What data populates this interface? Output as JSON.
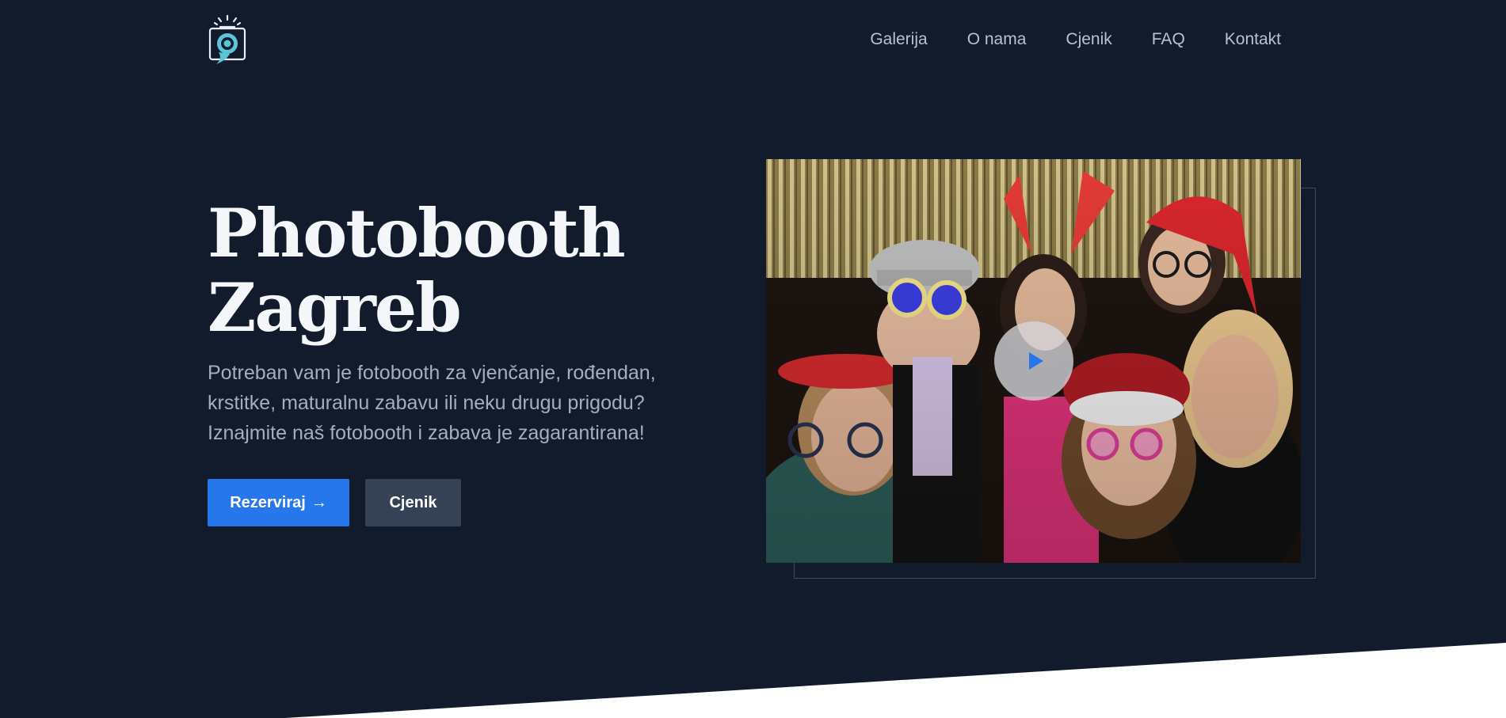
{
  "nav": {
    "items": [
      "Galerija",
      "O nama",
      "Cjenik",
      "FAQ",
      "Kontakt"
    ]
  },
  "hero": {
    "title_line1": "Photobooth",
    "title_line2": "Zagreb",
    "text": "Potreban vam je fotobooth za vjenčanje, rođendan, krstitke, maturalnu zabavu ili neku drugu prigodu? Iznajmite naš fotobooth i zabava je zagarantirana!",
    "btn_primary": "Rezerviraj",
    "btn_primary_arrow": "→",
    "btn_secondary": "Cjenik"
  },
  "icons": {
    "logo": "camera-pin-icon",
    "play": "play-icon"
  },
  "colors": {
    "background": "#111b2b",
    "primary": "#2676ec",
    "secondary": "#354154",
    "accent": "#5cc6d8"
  }
}
